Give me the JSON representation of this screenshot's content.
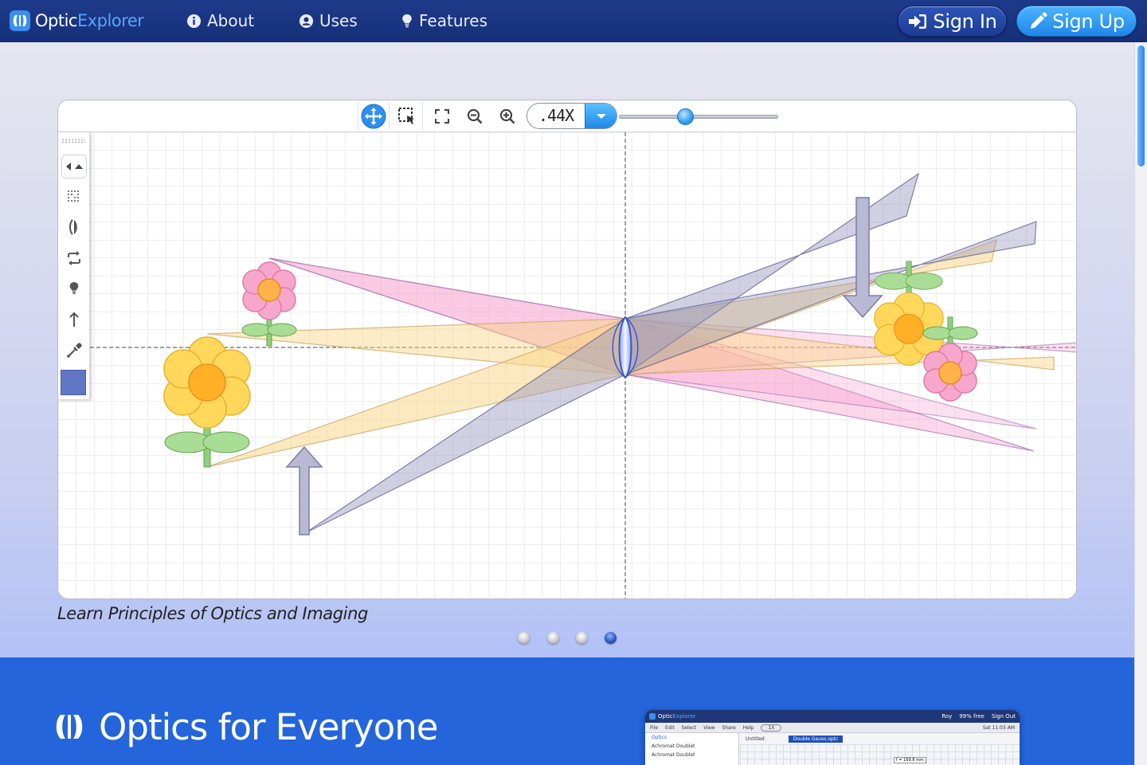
{
  "navbar": {
    "brand_prefix": "Optic",
    "brand_suffix": "Explorer",
    "links": [
      {
        "label": "About",
        "icon": "info-circle-icon"
      },
      {
        "label": "Uses",
        "icon": "user-circle-icon"
      },
      {
        "label": "Features",
        "icon": "lightbulb-icon"
      }
    ],
    "sign_in": "Sign In",
    "sign_up": "Sign Up"
  },
  "toolbar": {
    "zoom_value": ".44X",
    "zoom_level_fraction": 0.4
  },
  "hero": {
    "caption": "Learn Principles of Optics and Imaging",
    "slides": 4,
    "active_slide": 4,
    "swatch_color": "#6078c4"
  },
  "features": {
    "heading": "Optics for Everyone"
  },
  "preview": {
    "brand_prefix": "Optic",
    "brand_suffix": "Explorer",
    "user": "Roy",
    "storage": "99% free",
    "sign_out": "Sign Out",
    "menu": [
      "File",
      "Edit",
      "Select",
      "View",
      "Share",
      "Help"
    ],
    "zoom": "1X",
    "datetime": "Sat 11:03 AM",
    "doc_untitled": "Untitled",
    "doc_tab": "Double Gauss.optc",
    "sidebar_head": "Optics",
    "sidebar_items": [
      "Achromat Doublet",
      "Achromat Doublet"
    ],
    "focal": "f = 169.8 mm"
  },
  "colors": {
    "nav_bg": "#1d3a8a",
    "accent_blue": "#3b8df0",
    "features_bg": "#2465dc"
  }
}
